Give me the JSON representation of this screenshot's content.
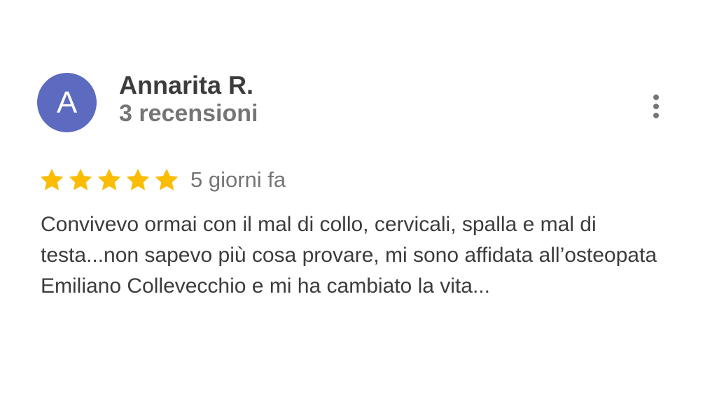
{
  "reviewer": {
    "initial": "A",
    "name": "Annarita R.",
    "review_count": "3 recensioni",
    "avatar_color": "#5c6bc0"
  },
  "rating": {
    "stars": 5,
    "max_stars": 5,
    "star_color": "#fbbc04",
    "date": "5 giorni fa"
  },
  "review": {
    "text": "Convivevo ormai con il mal di collo, cervicali, spalla e mal di testa...non sapevo più cosa provare, mi sono affidata all’osteopata Emiliano Collevecchio e mi ha cambiato la vita..."
  },
  "icons": {
    "menu": "more-vert-icon",
    "star": "star-icon"
  }
}
